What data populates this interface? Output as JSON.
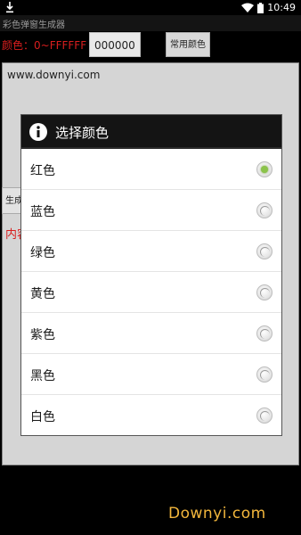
{
  "status_bar": {
    "time": "10:49"
  },
  "app": {
    "title": "彩色弹窗生成器",
    "color_label": "颜色：0~FFFFFF",
    "color_value": "000000",
    "common_colors_button": "常用颜色",
    "text_content": "www.downyi.com",
    "generate_button": "生成",
    "content_label": "内容"
  },
  "dialog": {
    "title": "选择颜色",
    "selected_index": 0,
    "options": [
      "红色",
      "蓝色",
      "绿色",
      "黄色",
      "紫色",
      "黑色",
      "白色"
    ],
    "accent_color": "#8bc34a"
  },
  "watermark": "Downyi.com"
}
